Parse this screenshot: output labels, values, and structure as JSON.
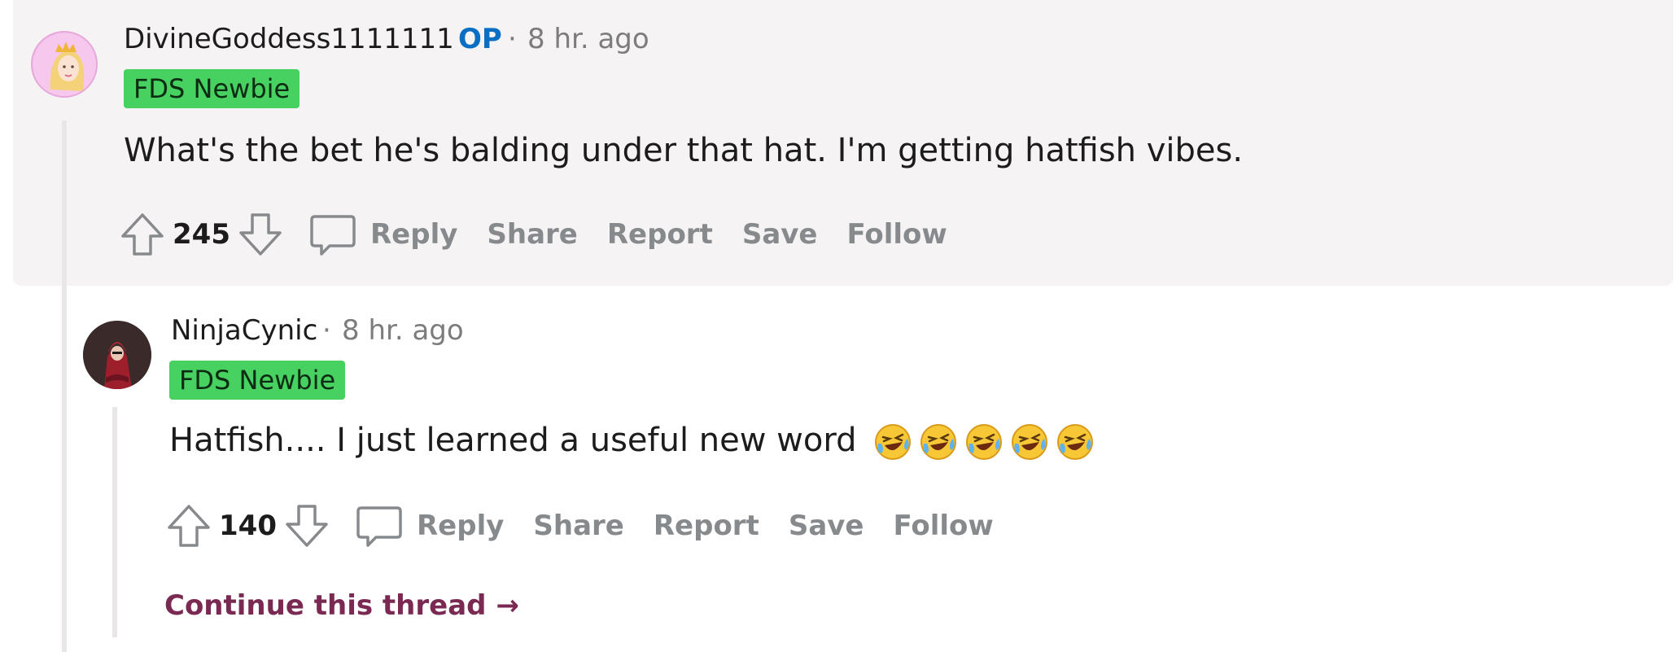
{
  "comments": [
    {
      "username": "DivineGoddess1111111",
      "op_label": "OP",
      "separator": "·",
      "time": "8 hr. ago",
      "flair": "FDS Newbie",
      "body": "What's the bet he's balding under that hat. I'm getting hatfish vibes.",
      "score": "245",
      "actions": {
        "reply": "Reply",
        "share": "Share",
        "report": "Report",
        "save": "Save",
        "follow": "Follow"
      }
    },
    {
      "username": "NinjaCynic",
      "separator": "·",
      "time": "8 hr. ago",
      "flair": "FDS Newbie",
      "body": "Hatfish.... I just learned a useful new word",
      "emoji_names": [
        "rofl-emoji",
        "rofl-emoji",
        "rofl-emoji",
        "rofl-emoji",
        "rofl-emoji"
      ],
      "score": "140",
      "actions": {
        "reply": "Reply",
        "share": "Share",
        "report": "Report",
        "save": "Save",
        "follow": "Follow"
      }
    }
  ],
  "continue_thread": "Continue this thread",
  "continue_arrow": "→",
  "colors": {
    "op_background": "#f6f3f4",
    "flair": "#46d160",
    "op_tag": "#0a6fc2",
    "action_gray": "#878a8c",
    "continue_link": "#7a2a52"
  }
}
